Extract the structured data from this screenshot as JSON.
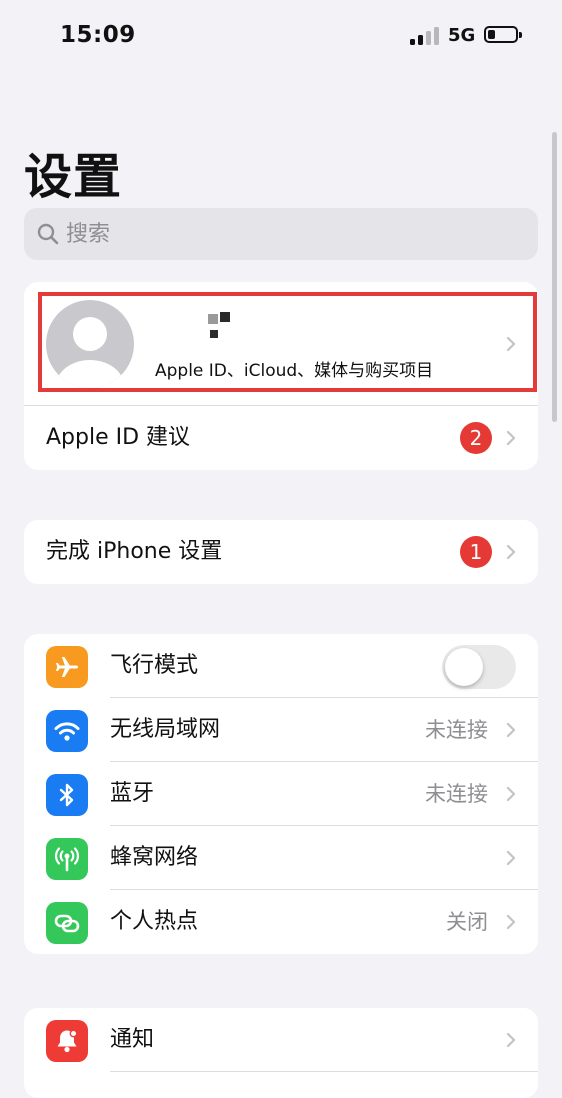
{
  "status_bar": {
    "time": "15:09",
    "network": "5G"
  },
  "page_title": "设置",
  "search": {
    "placeholder": "搜索"
  },
  "profile": {
    "subtitle": "Apple ID、iCloud、媒体与购买项目"
  },
  "apple_id_suggestions": {
    "label": "Apple ID 建议",
    "badge": "2"
  },
  "finish_setup": {
    "label": "完成 iPhone 设置",
    "badge": "1"
  },
  "connectivity": {
    "airplane": {
      "label": "飞行模式",
      "icon": "airplane-icon",
      "color": "#f79a1f",
      "toggle_on": false
    },
    "wifi": {
      "label": "无线局域网",
      "value": "未连接",
      "icon": "wifi-icon",
      "color": "#1a7cf2"
    },
    "bluetooth": {
      "label": "蓝牙",
      "value": "未连接",
      "icon": "bluetooth-icon",
      "color": "#1a7cf2"
    },
    "cellular": {
      "label": "蜂窝网络",
      "icon": "antenna-icon",
      "color": "#34c759"
    },
    "hotspot": {
      "label": "个人热点",
      "value": "关闭",
      "icon": "link-chain-icon",
      "color": "#34c759"
    }
  },
  "notifications": {
    "label": "通知",
    "icon": "bell-icon",
    "color": "#ef3b36"
  },
  "colors": {
    "badge": "#e53935",
    "highlight_border": "#e33a3a",
    "background": "#f2f2f7"
  }
}
